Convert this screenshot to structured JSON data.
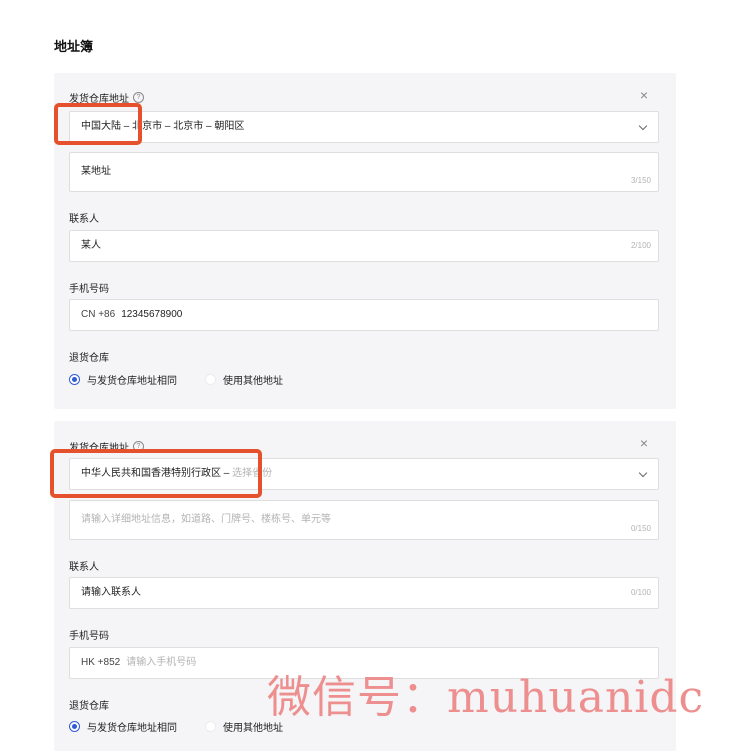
{
  "page_title": "地址簿",
  "colors": {
    "highlight": "#e5512d",
    "accent": "#2f5bd8",
    "watermark": "#ee8f8f"
  },
  "cards": [
    {
      "ship_label": "发货仓库地址",
      "region_value": "中国大陆 – 北京市 – 北京市 – 朝阳区",
      "region_placeholder": "",
      "address_value": "某地址",
      "address_placeholder": "",
      "address_counter": "3/150",
      "contact_label": "联系人",
      "contact_value": "某人",
      "contact_placeholder": "",
      "contact_counter": "2/100",
      "phone_label": "手机号码",
      "phone_code": "CN +86",
      "phone_value": "12345678900",
      "phone_placeholder": "",
      "return_label": "退货仓库",
      "return_same": "与发货仓库地址相同",
      "return_other": "使用其他地址"
    },
    {
      "ship_label": "发货仓库地址",
      "region_value": "中华人民共和国香港特别行政区 – ",
      "region_placeholder": "选择省份",
      "address_value": "",
      "address_placeholder": "请输入详细地址信息，如道路、门牌号、楼栋号、单元等",
      "address_counter": "0/150",
      "contact_label": "联系人",
      "contact_value": "",
      "contact_placeholder": "请输入联系人",
      "contact_counter": "0/100",
      "phone_label": "手机号码",
      "phone_code": "HK +852",
      "phone_value": "",
      "phone_placeholder": "请输入手机号码",
      "return_label": "退货仓库",
      "return_same": "与发货仓库地址相同",
      "return_other": "使用其他地址"
    }
  ],
  "watermark": "微信号：muhuanidc"
}
